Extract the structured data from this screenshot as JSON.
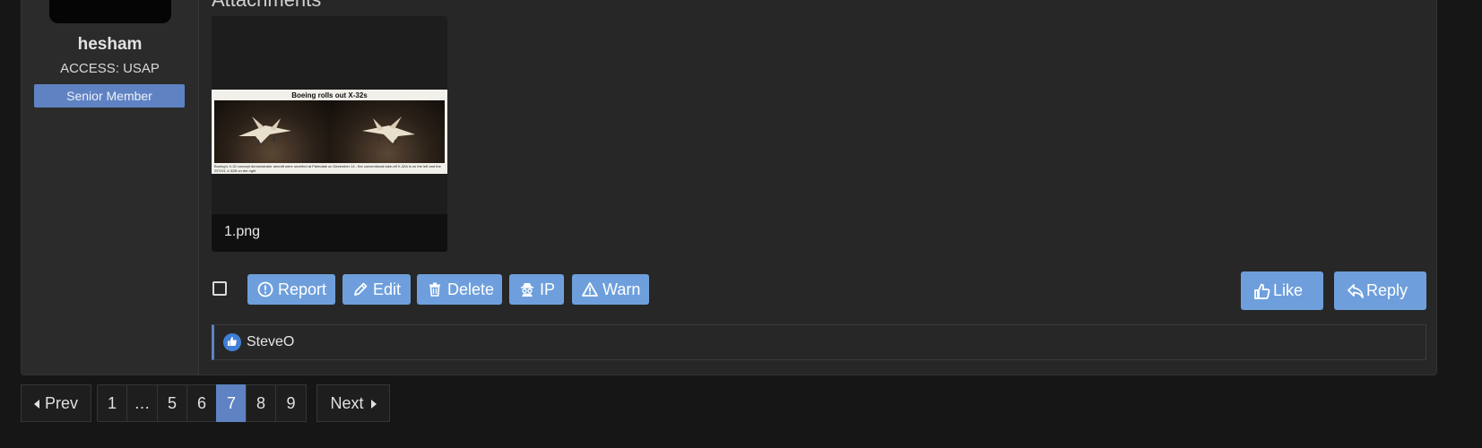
{
  "user": {
    "name": "hesham",
    "title": "ACCESS: USAP",
    "banner": "Senior Member"
  },
  "attachments": {
    "heading": "Attachments",
    "items": [
      {
        "filename": "1.png",
        "image_title": "Boeing rolls out X-32s",
        "image_caption": "Boeing's X-32 concept demonstrator aircraft were unveiled at Palmdale on December 14 - the conventional take-off X-32A is on the left and the STOVL X-32B on the right"
      }
    ]
  },
  "actions": {
    "report": "Report",
    "edit": "Edit",
    "delete": "Delete",
    "ip": "IP",
    "warn": "Warn",
    "like": "Like",
    "reply": "Reply"
  },
  "likes": {
    "users": "SteveO"
  },
  "pagination": {
    "prev": "Prev",
    "next": "Next",
    "pages": [
      "1",
      "…",
      "5",
      "6",
      "7",
      "8",
      "9"
    ],
    "current": "7"
  },
  "colors": {
    "accent": "#6e9fdc",
    "banner": "#5f82c2",
    "background": "#161616",
    "panel": "#272727"
  }
}
